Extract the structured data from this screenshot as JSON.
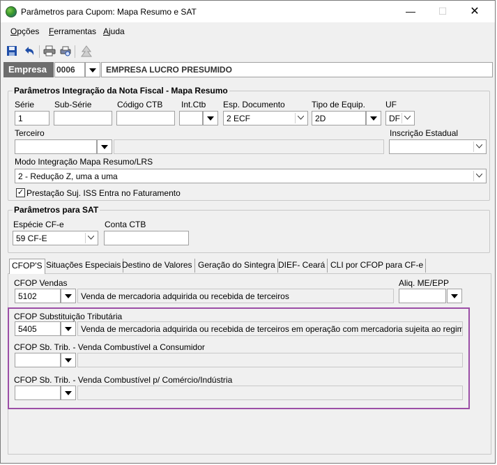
{
  "window": {
    "title": "Parâmetros para Cupom: Mapa Resumo e SAT",
    "minimize": "—",
    "maximize": "☐",
    "close": "✕"
  },
  "menu": {
    "opcoes": {
      "ul": "O",
      "rest": "pções"
    },
    "ferramentas": {
      "ul": "F",
      "rest": "erramentas"
    },
    "ajuda": {
      "ul": "A",
      "rest": "juda"
    }
  },
  "toolbar": {
    "icons": [
      "save-icon",
      "undo-icon",
      "print-icon",
      "print-preview-icon",
      "tree-icon"
    ]
  },
  "empresa": {
    "label": "Empresa",
    "code": "0006",
    "name": "EMPRESA LUCRO PRESUMIDO"
  },
  "mapa_resumo": {
    "title": "Parâmetros Integração da Nota Fiscal - Mapa Resumo",
    "serie_label": "Série",
    "serie_value": "1",
    "subserie_label": "Sub-Série",
    "subserie_value": "",
    "codigo_ctb_label": "Código CTB",
    "codigo_ctb_value": "",
    "int_ctb_label": "Int.Ctb",
    "int_ctb_value": "",
    "esp_doc_label": "Esp. Documento",
    "esp_doc_value": "2 ECF",
    "tipo_equip_label": "Tipo de Equip.",
    "tipo_equip_value": "2D",
    "uf_label": "UF",
    "uf_value": "DF",
    "terceiro_label": "Terceiro",
    "terceiro_value": "",
    "inscricao_label": "Inscrição Estadual",
    "inscricao_value": "",
    "modo_label": "Modo Integração Mapa Resumo/LRS",
    "modo_value": "2 - Redução Z, uma a uma",
    "iss_checkbox_label": "Prestação Suj. ISS Entra no Faturamento",
    "iss_checked": true
  },
  "sat": {
    "title": "Parâmetros para SAT",
    "especie_label": "Espécie CF-e",
    "especie_value": "59 CF-E",
    "conta_ctb_label": "Conta CTB",
    "conta_ctb_value": ""
  },
  "tabs": [
    "CFOP'S",
    "Situações Especiais",
    "Destino de Valores",
    "Geração do Sintegra",
    "DIEF- Ceará",
    "CLI por CFOP para CF-e"
  ],
  "cfop": {
    "vendas_label": "CFOP Vendas",
    "vendas_code": "5102",
    "vendas_desc": "Venda de mercadoria adquirida ou recebida de terceiros",
    "aliq_label": "Aliq. ME/EPP",
    "aliq_value": "",
    "subst_label": "CFOP Substituição Tributária",
    "subst_code": "5405",
    "subst_desc": "Venda de mercadoria adquirida ou recebida de terceiros em operação com mercadoria sujeita ao regime de s",
    "comb_consumidor_label": "CFOP Sb. Trib. - Venda Combustível a Consumidor",
    "comb_consumidor_code": "",
    "comb_consumidor_desc": "",
    "comb_comercio_label": "CFOP Sb. Trib. - Venda Combustível p/ Comércio/Indústria",
    "comb_comercio_code": "",
    "comb_comercio_desc": ""
  },
  "colors": {
    "highlight": "#9b4ea6",
    "empresa_label_bg": "#6d6d6d",
    "window_bg": "#f0f0f0"
  }
}
